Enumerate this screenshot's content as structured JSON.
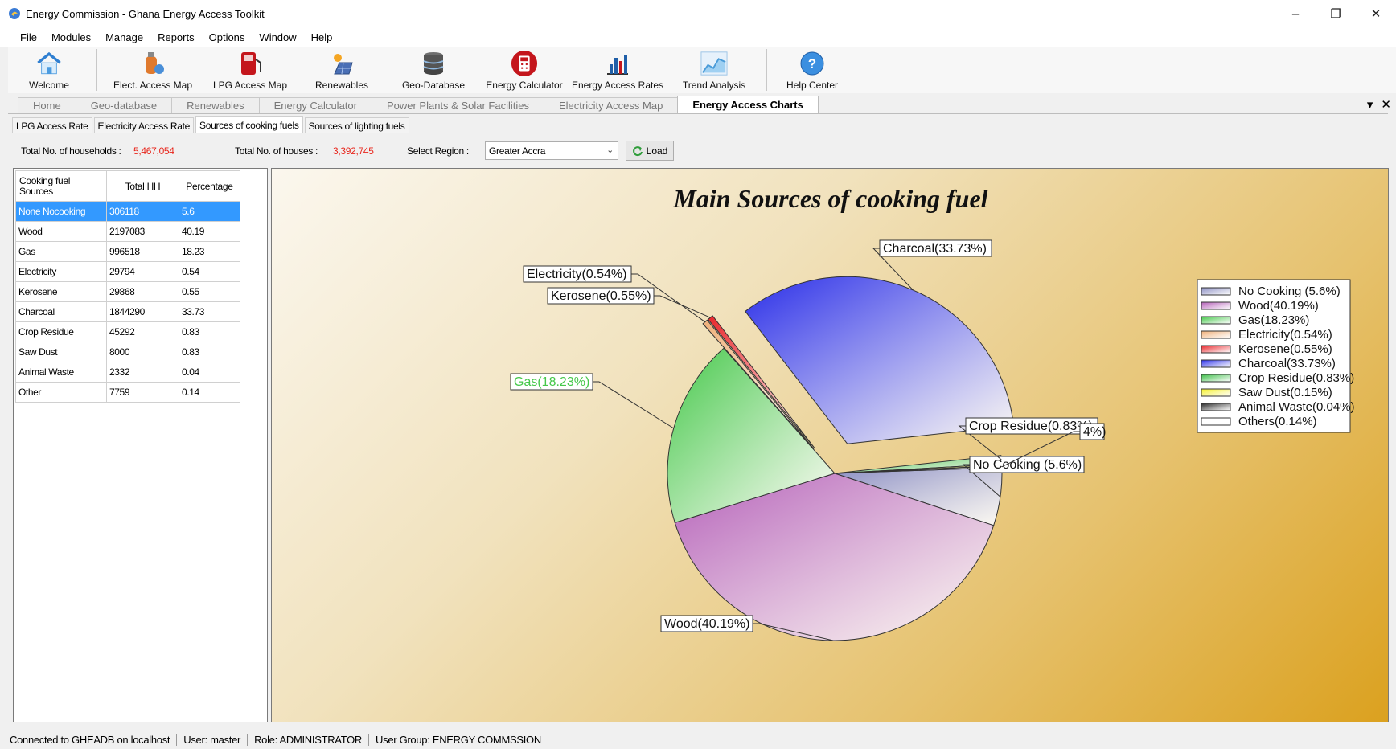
{
  "window": {
    "title": "Energy Commission - Ghana Energy Access Toolkit",
    "minimize": "–",
    "restore": "❐",
    "close": "✕"
  },
  "menu": [
    "File",
    "Modules",
    "Manage",
    "Reports",
    "Options",
    "Window",
    "Help"
  ],
  "toolbar": [
    {
      "label": "Welcome",
      "icon": "house-icon"
    },
    {
      "label": "Elect. Access Map",
      "icon": "gas-cylinder-icon"
    },
    {
      "label": "LPG Access Map",
      "icon": "fuel-pump-icon"
    },
    {
      "label": "Renewables",
      "icon": "solar-panel-icon"
    },
    {
      "label": "Geo-Database",
      "icon": "database-icon"
    },
    {
      "label": "Energy Calculator",
      "icon": "calculator-icon"
    },
    {
      "label": "Energy Access Rates",
      "icon": "bar-chart-icon"
    },
    {
      "label": "Trend Analysis",
      "icon": "area-chart-icon"
    },
    {
      "label": "Help Center",
      "icon": "help-icon"
    }
  ],
  "main_tabs": [
    {
      "label": "Home",
      "active": false
    },
    {
      "label": "Geo-database",
      "active": false
    },
    {
      "label": "Renewables",
      "active": false
    },
    {
      "label": "Energy Calculator",
      "active": false
    },
    {
      "label": "Power Plants & Solar Facilities",
      "active": false
    },
    {
      "label": "Electricity Access Map",
      "active": false
    },
    {
      "label": "Energy Access Charts",
      "active": true
    }
  ],
  "tab_controls": {
    "dropdown": "▾",
    "close": "✕"
  },
  "sub_tabs": [
    {
      "label": "LPG Access Rate",
      "active": false
    },
    {
      "label": "Electricity Access Rate",
      "active": false
    },
    {
      "label": "Sources of cooking fuels",
      "active": true
    },
    {
      "label": "Sources of lighting fuels",
      "active": false
    }
  ],
  "info": {
    "households_label": "Total No. of households :",
    "households_value": "5,467,054",
    "houses_label": "Total No. of houses :",
    "houses_value": "3,392,745",
    "region_label": "Select Region :",
    "region_value": "Greater Accra",
    "load_label": "Load"
  },
  "table": {
    "headers": [
      "Cooking fuel Sources",
      "Total HH",
      "Percentage"
    ],
    "rows": [
      [
        "None Nocooking",
        "306118",
        "5.6"
      ],
      [
        "Wood",
        "2197083",
        "40.19"
      ],
      [
        "Gas",
        "996518",
        "18.23"
      ],
      [
        "Electricity",
        "29794",
        "0.54"
      ],
      [
        "Kerosene",
        "29868",
        "0.55"
      ],
      [
        "Charcoal",
        "1844290",
        "33.73"
      ],
      [
        "Crop Residue",
        "45292",
        "0.83"
      ],
      [
        "Saw Dust",
        "8000",
        "0.83"
      ],
      [
        "Animal Waste",
        "2332",
        "0.04"
      ],
      [
        "Other",
        "7759",
        "0.14"
      ]
    ],
    "selected_row": 0
  },
  "chart_data": {
    "type": "pie",
    "title": "Main Sources of cooking fuel",
    "legend_position": "right",
    "slices": [
      {
        "label": "No Cooking (5.6%)",
        "legend": "No Cooking (5.6%)",
        "value": 5.6,
        "color": "#8c8fc4",
        "exploded": false
      },
      {
        "label": "Wood(40.19%)",
        "legend": "Wood(40.19%)",
        "value": 40.19,
        "color": "#b561b9",
        "exploded": false
      },
      {
        "label": "Gas(18.23%)",
        "legend": "Gas(18.23%)",
        "value": 18.23,
        "color": "#45c84a",
        "exploded": false
      },
      {
        "label": "Electricity(0.54%)",
        "legend": "Electricity(0.54%)",
        "value": 0.54,
        "color": "#f0b07a",
        "exploded": true
      },
      {
        "label": "Kerosene(0.55%)",
        "legend": "Kerosene(0.55%)",
        "value": 0.55,
        "color": "#e8262b",
        "exploded": true
      },
      {
        "label": "Charcoal(33.73%)",
        "legend": "Charcoal(33.73%)",
        "value": 33.73,
        "color": "#2a2ee8",
        "exploded": true
      },
      {
        "label": "Crop Residue(0.83%)",
        "legend": "Crop Residue(0.83%)",
        "value": 0.83,
        "color": "#3cbf48",
        "exploded": false
      },
      {
        "label": "",
        "legend": "Saw Dust(0.15%)",
        "value": 0.15,
        "color": "#f4f02a",
        "exploded": false
      },
      {
        "label": "",
        "legend": "Animal Waste(0.04%)",
        "value": 0.04,
        "color": "#2c2c2c",
        "exploded": false
      },
      {
        "label": "4%)",
        "legend": "Others(0.14%)",
        "value": 0.14,
        "color": "#ffffff",
        "exploded": false
      }
    ]
  },
  "status": [
    "Connected to GHEADB on localhost",
    "User: master",
    "Role: ADMINISTRATOR",
    "User Group: ENERGY COMMSSION"
  ]
}
